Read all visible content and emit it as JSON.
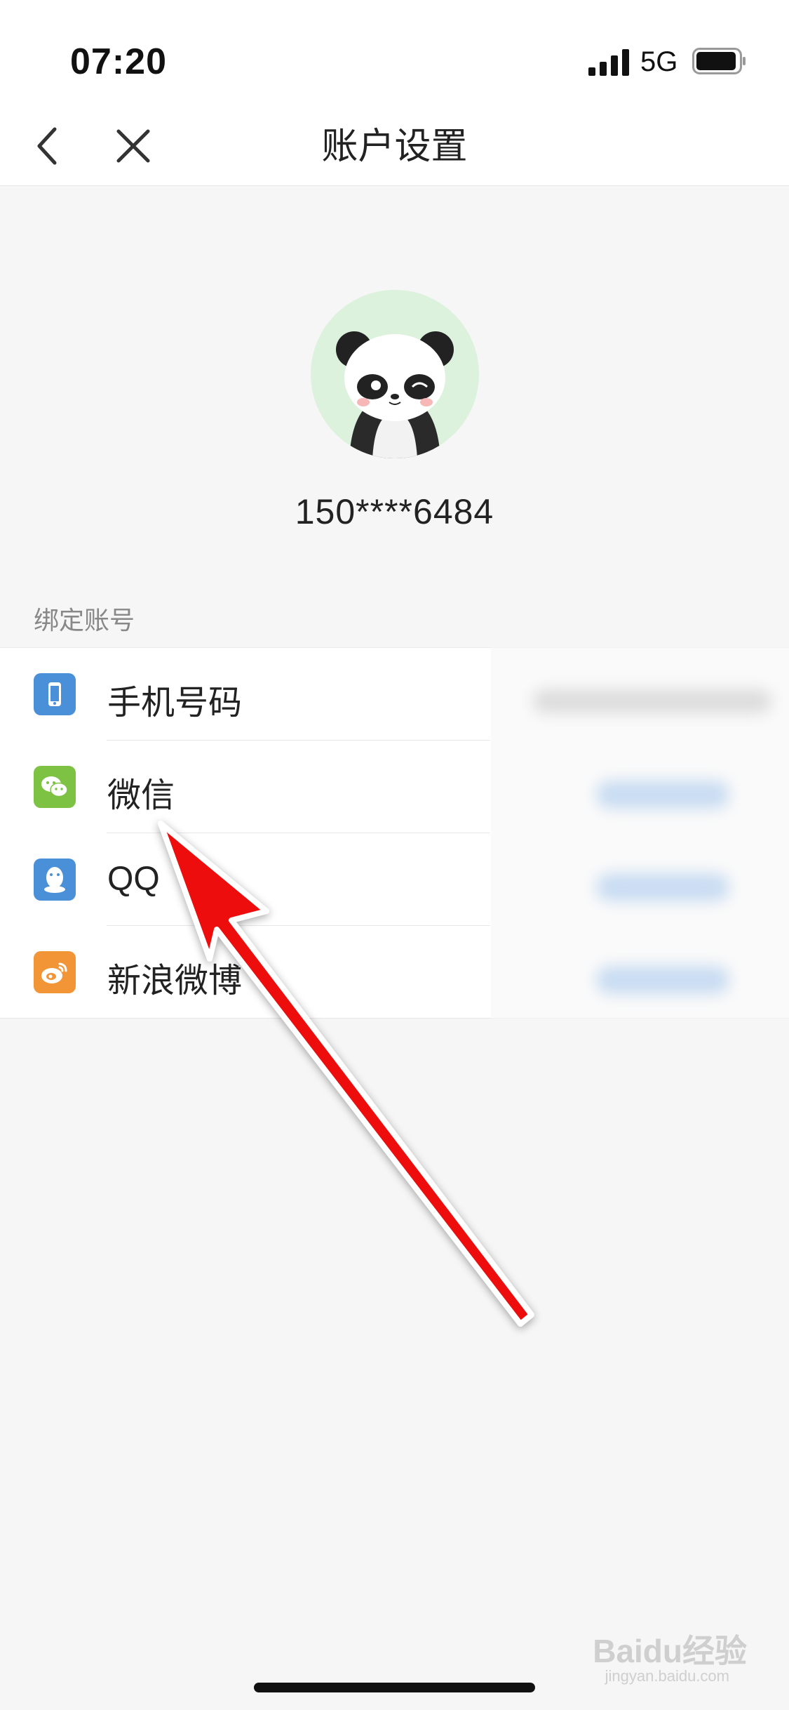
{
  "status_bar": {
    "time": "07:20",
    "network": "5G"
  },
  "nav": {
    "title": "账户设置"
  },
  "profile": {
    "phone": "150****6484"
  },
  "section": {
    "label": "绑定账号"
  },
  "bind_items": [
    {
      "label": "手机号码",
      "icon": "phone-icon",
      "color": "#4a90d9"
    },
    {
      "label": "微信",
      "icon": "wechat-icon",
      "color": "#7dc242"
    },
    {
      "label": "QQ",
      "icon": "qq-icon",
      "color": "#4a90d9"
    },
    {
      "label": "新浪微博",
      "icon": "weibo-icon",
      "color": "#f29537"
    }
  ],
  "watermark": {
    "brand": "Baidu经验",
    "url": "jingyan.baidu.com"
  },
  "colors": {
    "arrow": "#ee1111",
    "avatar_bg": "#dcf2dc"
  }
}
